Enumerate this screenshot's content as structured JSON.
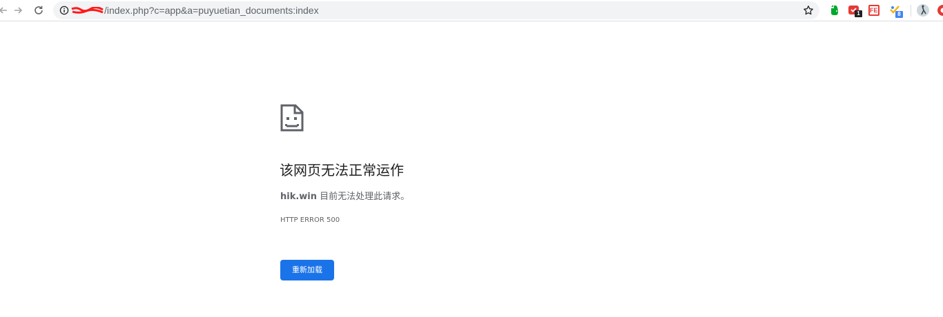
{
  "browser": {
    "url_path": "/index.php?c=app&a=puyuetian_documents:index",
    "extensions": [
      {
        "name": "evernote",
        "badge": ""
      },
      {
        "name": "todo",
        "badge": "1"
      },
      {
        "name": "fe",
        "label": "FE",
        "badge": ""
      },
      {
        "name": "checker",
        "badge": "8"
      }
    ]
  },
  "error_page": {
    "title": "该网页无法正常运作",
    "host": "hik.win",
    "message": " 目前无法处理此请求。",
    "code": "HTTP ERROR 500",
    "reload_label": "重新加载"
  },
  "colors": {
    "accent": "#1a73e8",
    "text_primary": "#202124",
    "text_secondary": "#5f6368"
  }
}
